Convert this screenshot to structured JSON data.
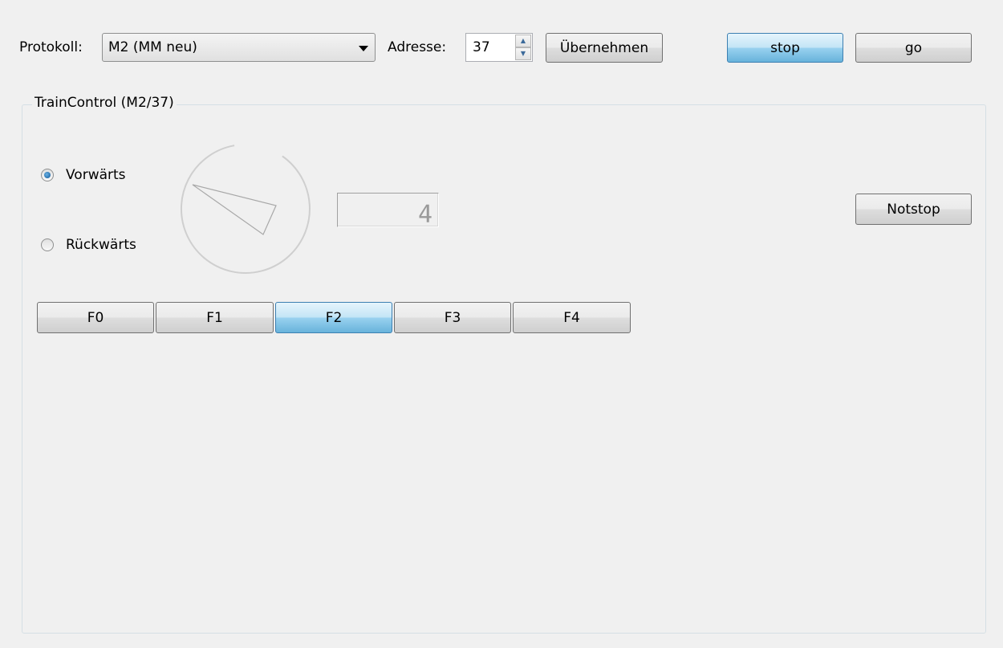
{
  "toolbar": {
    "protocol_label": "Protokoll:",
    "protocol_value": "M2 (MM neu)",
    "address_label": "Adresse:",
    "address_value": "37",
    "apply_label": "Übernehmen",
    "stop_label": "stop",
    "go_label": "go"
  },
  "train_control": {
    "title": "TrainControl (M2/37)",
    "direction_forward": "Vorwärts",
    "direction_backward": "Rückwärts",
    "direction_selected": "forward",
    "speed_value": 4,
    "speed_display": "4",
    "emergency_stop_label": "Notstop",
    "functions": [
      {
        "label": "F0",
        "active": false
      },
      {
        "label": "F1",
        "active": false
      },
      {
        "label": "F2",
        "active": true
      },
      {
        "label": "F3",
        "active": false
      },
      {
        "label": "F4",
        "active": false
      }
    ]
  },
  "colors": {
    "window_bg": "#f0f0f0",
    "active_button": "#98d1ef",
    "group_border": "#d5dfe5"
  }
}
